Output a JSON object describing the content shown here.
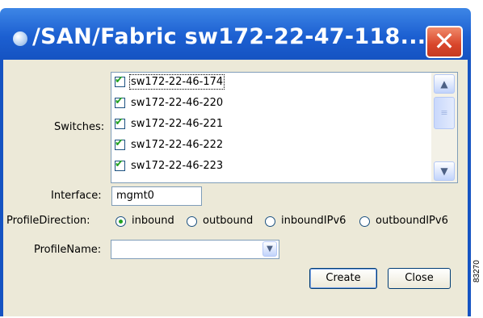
{
  "window": {
    "title": "/SAN/Fabric sw172-22-47-118...",
    "close_label": "✕"
  },
  "switches": {
    "label": "Switches:",
    "items": [
      {
        "name": "sw172-22-46-174",
        "checked": true
      },
      {
        "name": "sw172-22-46-220",
        "checked": true
      },
      {
        "name": "sw172-22-46-221",
        "checked": true
      },
      {
        "name": "sw172-22-46-222",
        "checked": true
      },
      {
        "name": "sw172-22-46-223",
        "checked": true
      }
    ],
    "scroll_up": "▲",
    "scroll_down": "▼",
    "thumb_grip": "≡"
  },
  "interface": {
    "label": "Interface:",
    "value": "mgmt0"
  },
  "profile_direction": {
    "label": "ProfileDirection:",
    "options": [
      {
        "label": "inbound",
        "selected": true
      },
      {
        "label": "outbound",
        "selected": false
      },
      {
        "label": "inboundIPv6",
        "selected": false
      },
      {
        "label": "outboundIPv6",
        "selected": false
      }
    ]
  },
  "profile_name": {
    "label": "ProfileName:",
    "value": "",
    "arrow": "▼"
  },
  "buttons": {
    "create": "Create",
    "close": "Close"
  },
  "figure_id": "83270",
  "colors": {
    "titlebar": "#1c5fd1",
    "close_button": "#d8452a",
    "dialog_bg": "#ece9d8",
    "check": "#21a121"
  }
}
